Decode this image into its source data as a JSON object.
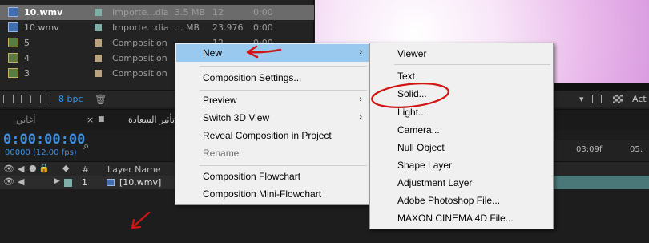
{
  "project": {
    "rows": [
      {
        "name": "10.wmv",
        "type": "Importe...dia",
        "size": "3.5 MB",
        "fps": "12",
        "dur": "0:00",
        "kind": "video",
        "label_color": "#7fb0a8",
        "selected": true
      },
      {
        "name": "10.wmv",
        "type": "Importe...dia",
        "size": "... MB",
        "fps": "23.976",
        "dur": "0:00",
        "kind": "video",
        "label_color": "#7fb0a8",
        "selected": false
      },
      {
        "name": "5",
        "type": "Composition",
        "size": "",
        "fps": "12",
        "dur": "0:00",
        "kind": "comp",
        "label_color": "#b9a37f",
        "selected": false
      },
      {
        "name": "4",
        "type": "Composition",
        "size": "",
        "fps": "",
        "dur": "",
        "kind": "comp",
        "label_color": "#b9a37f",
        "selected": false
      },
      {
        "name": "3",
        "type": "Composition",
        "size": "",
        "fps": "",
        "dur": "",
        "kind": "comp",
        "label_color": "#b9a37f",
        "selected": false
      }
    ],
    "bpc": "8 bpc"
  },
  "viewer": {
    "act_label": "Act"
  },
  "timeline": {
    "tab1": "أغاني",
    "tab2": "تأثير السعادة",
    "timecode": "0:00:00:00",
    "fps_text": "00000 (12.00 fps)",
    "col_num": "#",
    "col_layer": "Layer Name",
    "layer_num": "1",
    "layer_name": "[10.wmv]",
    "ruler_ticks": [
      "03:09f",
      "05:"
    ]
  },
  "main_menu": {
    "items": [
      {
        "label": "New",
        "submenu": true,
        "highlighted": true
      },
      {
        "label": "Composition Settings...",
        "submenu": false
      },
      {
        "label": "Preview",
        "submenu": true
      },
      {
        "label": "Switch 3D View",
        "submenu": true
      },
      {
        "label": "Reveal Composition in Project",
        "submenu": false
      },
      {
        "label": "Rename",
        "submenu": false,
        "disabled": true
      },
      {
        "label": "Composition Flowchart",
        "submenu": false
      },
      {
        "label": "Composition Mini-Flowchart",
        "submenu": false
      }
    ]
  },
  "sub_menu": {
    "items": [
      {
        "label": "Viewer"
      },
      {
        "label": "Text"
      },
      {
        "label": "Solid..."
      },
      {
        "label": "Light..."
      },
      {
        "label": "Camera..."
      },
      {
        "label": "Null Object"
      },
      {
        "label": "Shape Layer"
      },
      {
        "label": "Adjustment Layer"
      },
      {
        "label": "Adobe Photoshop File..."
      },
      {
        "label": "MAXON CINEMA 4D File..."
      }
    ]
  },
  "annotation_color": "#d11414"
}
